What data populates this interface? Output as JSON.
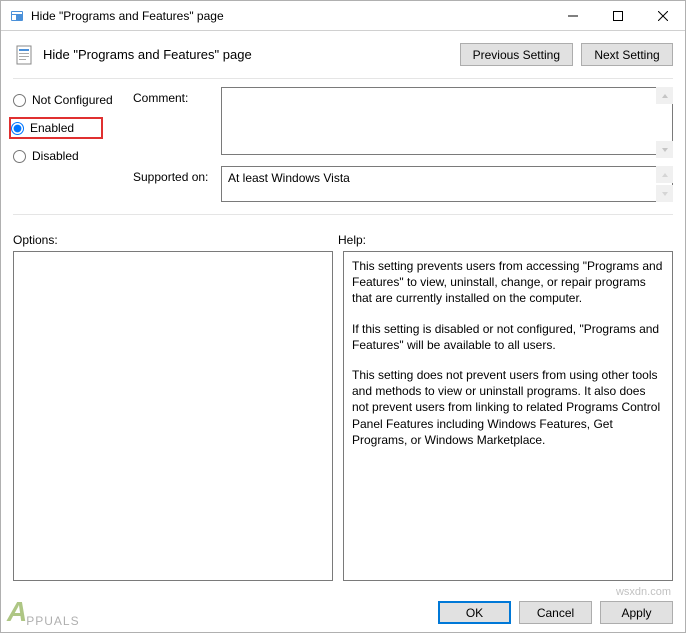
{
  "window": {
    "title": "Hide \"Programs and Features\" page"
  },
  "header": {
    "title": "Hide \"Programs and Features\" page",
    "previous_btn": "Previous Setting",
    "next_btn": "Next Setting"
  },
  "radios": {
    "not_configured": "Not Configured",
    "enabled": "Enabled",
    "disabled": "Disabled",
    "selected": "enabled"
  },
  "form": {
    "comment_label": "Comment:",
    "comment_value": "",
    "supported_label": "Supported on:",
    "supported_value": "At least Windows Vista"
  },
  "labels": {
    "options": "Options:",
    "help": "Help:"
  },
  "help": {
    "p1": "This setting prevents users from accessing \"Programs and Features\" to view, uninstall, change, or repair programs that are currently installed on the computer.",
    "p2": "If this setting is disabled or not configured, \"Programs and Features\" will be available to all users.",
    "p3": "This setting does not prevent users from using other tools and methods to view or uninstall programs.  It also does not prevent users from linking to related Programs Control Panel Features including Windows Features, Get Programs, or Windows Marketplace."
  },
  "footer": {
    "ok": "OK",
    "cancel": "Cancel",
    "apply": "Apply"
  },
  "watermark": {
    "brand": "PPUALS",
    "site": "wsxdn.com"
  }
}
